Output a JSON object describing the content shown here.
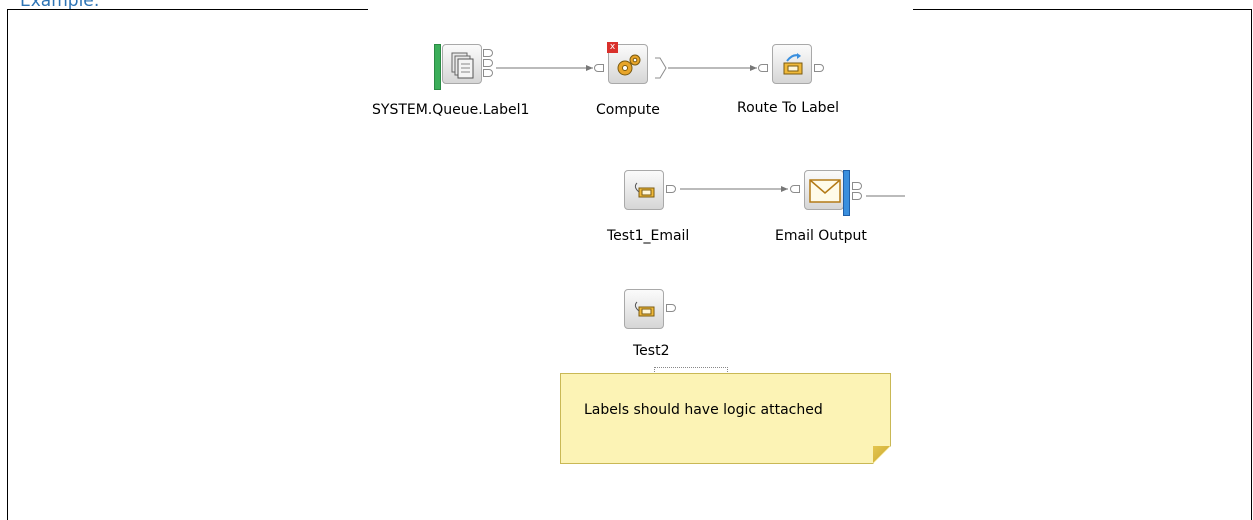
{
  "heading": "Example:",
  "nodes": {
    "queue_input": {
      "label": "SYSTEM.Queue.Label1",
      "icon": "mq-input-icon"
    },
    "compute": {
      "label": "Compute",
      "icon": "compute-gears-icon",
      "error_badge": "x"
    },
    "route_to_label": {
      "label": "Route To Label",
      "icon": "route-to-label-icon"
    },
    "test1_email": {
      "label": "Test1_Email",
      "icon": "label-tag-icon"
    },
    "email_output": {
      "label": "Email Output",
      "icon": "email-envelope-icon"
    },
    "test2": {
      "label": "Test2",
      "icon": "label-tag-icon"
    }
  },
  "note": {
    "text": "Labels should have logic attached"
  },
  "colors": {
    "heading": "#2e74b5",
    "note_bg": "#fcf3b5",
    "input_bar": "#3cae5a",
    "output_bar": "#3a8fde",
    "error": "#d9302b"
  }
}
